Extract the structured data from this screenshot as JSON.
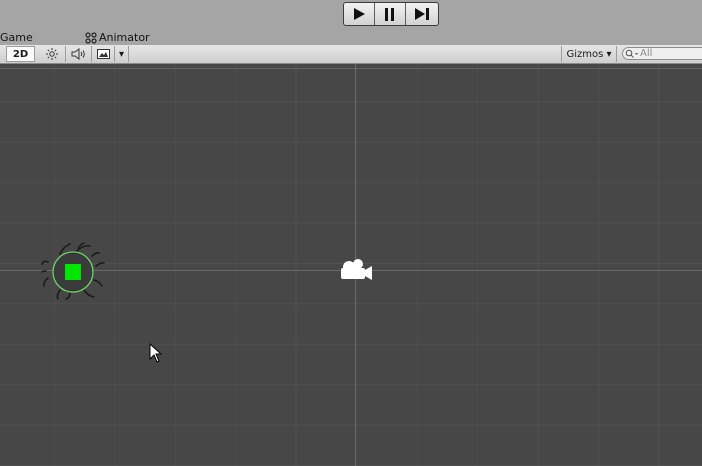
{
  "playbar": {
    "buttons": [
      "play",
      "pause",
      "step"
    ]
  },
  "tabs": {
    "game": "Game",
    "animator": "Animator"
  },
  "toolbar": {
    "mode_2d": "2D",
    "fx_dropdown": "▾",
    "gizmos": "Gizmos ▾",
    "search_placeholder": "All"
  },
  "icons": {
    "play": "play-icon",
    "pause": "pause-icon",
    "step": "step-icon",
    "animator": "animator-icon",
    "light": "light-icon",
    "audio": "audio-icon",
    "effects": "image-icon",
    "search": "search-icon",
    "camera": "camera-gizmo-icon"
  },
  "colors": {
    "scene_bg": "#474747",
    "player_fill": "#00e600",
    "collider": "#6fd36f",
    "toolbar_bg": "#d6d6d6"
  }
}
